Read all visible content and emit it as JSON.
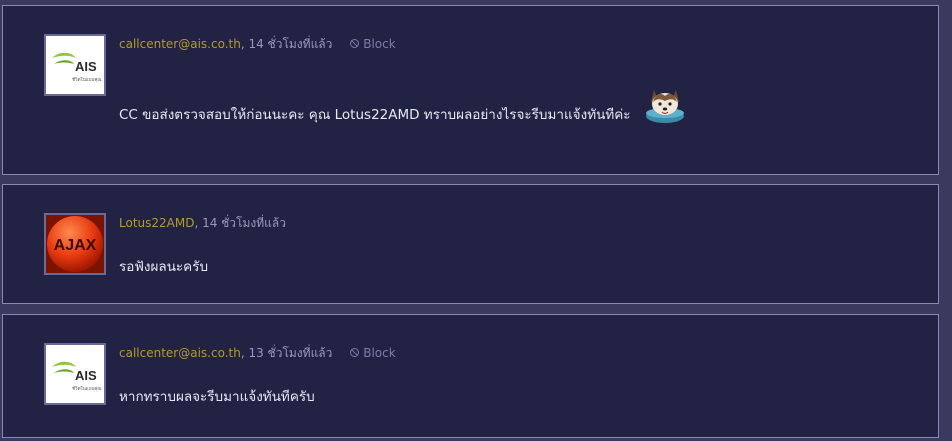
{
  "comments": [
    {
      "author": "callcenter@ais.co.th",
      "time": ", 14 ชั่วโมงที่แล้ว",
      "block_label": "Block",
      "text": "CC ขอส่งตรวจสอบให้ก่อนนะคะ คุณ  Lotus22AMD ทราบผลอย่างไรจะรีบมาแจ้งทันทีค่ะ",
      "avatar_brand": "AIS",
      "avatar_tagline": "ชีวิตในแบบคุณ"
    },
    {
      "author": "Lotus22AMD",
      "time": ", 14 ชั่วโมงที่แล้ว",
      "text": "รอฟังผลนะครับ",
      "avatar_brand": "AJAX"
    },
    {
      "author": "callcenter@ais.co.th",
      "time": ", 13 ชั่วโมงที่แล้ว",
      "block_label": "Block",
      "text": "หากทราบผลจะรีบมาแจ้งทันทีครับ",
      "avatar_brand": "AIS",
      "avatar_tagline": "ชีวิตในแบบคุณ"
    }
  ],
  "colors": {
    "background": "#3a3a5e",
    "card": "#222244",
    "author": "#b59a2c",
    "text": "#e8e8f2"
  }
}
